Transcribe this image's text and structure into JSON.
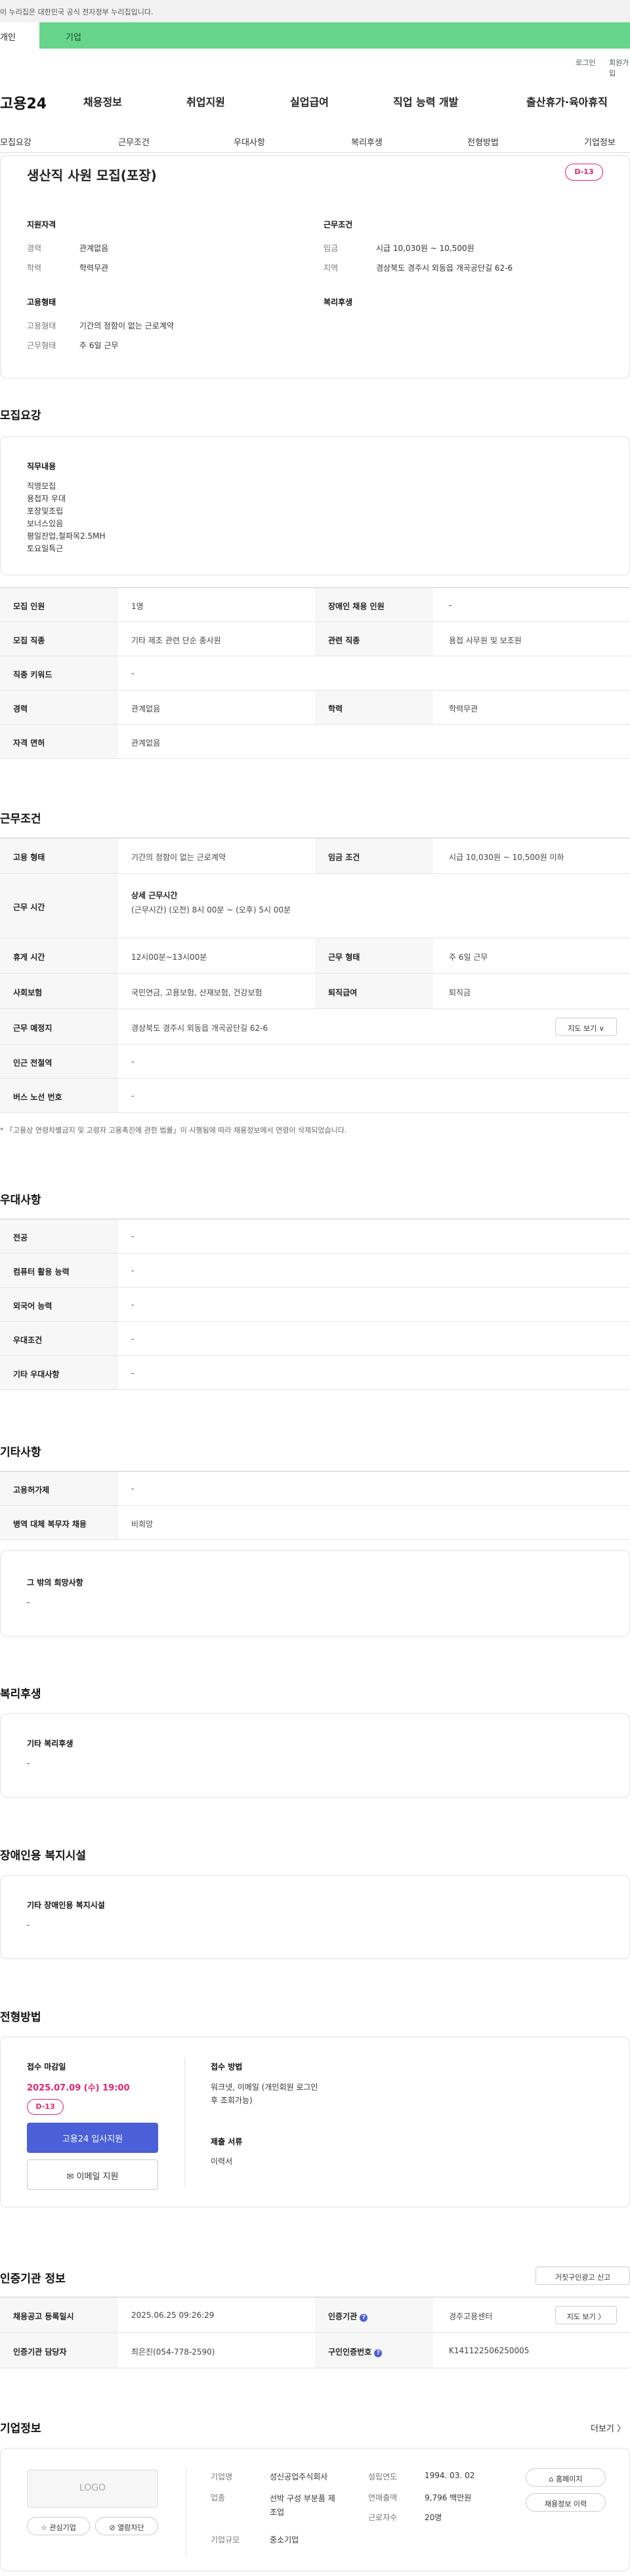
{
  "gov": "이 누리집은 대한민국 공식 전자정부 누리집입니다.",
  "tabs": {
    "person": "개인",
    "company": "기업"
  },
  "util": {
    "login": "로그인",
    "join": "회원가입"
  },
  "logo": "고용24",
  "gnb": [
    "채용정보",
    "취업지원",
    "실업급여",
    "직업 능력 개발",
    "출산휴가·육아휴직"
  ],
  "subnav": [
    "모집요강",
    "근무조건",
    "우대사항",
    "복리후생",
    "전형방법",
    "기업정보"
  ],
  "summary": {
    "title": "생산직 사원 모집(포장)",
    "dday": "D-13",
    "qual_h": "지원자격",
    "career_l": "경력",
    "career_v": "관계없음",
    "edu_l": "학력",
    "edu_v": "학력무관",
    "cond_h": "근무조건",
    "wage_l": "임금",
    "wage_v": "시급 10,030원 ~ 10,500원",
    "loc_l": "지역",
    "loc_v": "경상북도 경주시 외동읍 개곡공단길 62-6",
    "emp_h": "고용형태",
    "emp_l": "고용형태",
    "emp_v": "기간의 정함이 없는 근로계약",
    "work_l": "근무형태",
    "work_v": "주 6일 근무",
    "welfare_h": "복리후생"
  },
  "recruit": {
    "h": "모집요강",
    "duty_h": "직무내용",
    "duty_lines": [
      "직영모집",
      "용접자 우대",
      "포장및조립",
      "보너스있음",
      "평일잔업,철파목2.5MH",
      "토요일특근"
    ],
    "rows": [
      [
        "모집 인원",
        "1명",
        "장애인 채용 인원",
        "-"
      ],
      [
        "모집 직종",
        "기타 제조 관련 단순 종사원",
        "관련 직종",
        "용접 사무원 및 보조원"
      ],
      [
        "직종 키워드",
        "-"
      ],
      [
        "경력",
        "관계없음",
        "학력",
        "학력무관"
      ],
      [
        "자격 면허",
        "관계없음"
      ]
    ]
  },
  "cond": {
    "h": "근무조건",
    "r1": [
      "고용 형태",
      "기간의 정함이 없는 근로계약",
      "임금 조건",
      "시급 10,030원 ~ 10,500원 이하"
    ],
    "r2": [
      "근무 시간",
      "상세 근무시간",
      "(근무시간) (오전) 8시 00분 ~ (오후) 5시 00분"
    ],
    "r3": [
      "휴게 시간",
      "12시00분~13시00분",
      "근무 형태",
      "주 6일 근무"
    ],
    "r4": [
      "사회보험",
      "국민연금, 고용보험, 산재보험, 건강보험",
      "퇴직급여",
      "퇴직금"
    ],
    "r5": [
      "근무 예정지",
      "경상북도 경주시 외동읍 개곡공단길 62-6",
      "지도 보기 ∨"
    ],
    "r6": [
      "인근 전철역",
      "-"
    ],
    "r7": [
      "버스 노선 번호",
      "-"
    ],
    "note": "* 「고용상 연령차별금지 및 고령자 고용촉진에 관한 법률」이 시행됨에 따라 채용정보에서 연령이 삭제되었습니다."
  },
  "pref": {
    "h": "우대사항",
    "rows": [
      [
        "전공",
        "-"
      ],
      [
        "컴퓨터 활용 능력",
        "-"
      ],
      [
        "외국어 능력",
        "-"
      ],
      [
        "우대조건",
        "-"
      ],
      [
        "기타 우대사항",
        "-"
      ]
    ]
  },
  "etc": {
    "h": "기타사항",
    "rows": [
      [
        "고용허가제",
        "-"
      ],
      [
        "병역 대체 복무자 채용",
        "비희망"
      ]
    ],
    "other_h": "그 밖의 희망사항",
    "other_v": "-"
  },
  "welfare": {
    "h": "복리후생",
    "sub": "기타 복리후생",
    "v": "-"
  },
  "disab": {
    "h": "장애인용 복지시설",
    "sub": "기타 장애인용 복지시설",
    "v": "-"
  },
  "screen": {
    "h": "전형방법",
    "deadline_l": "접수 마감일",
    "deadline_v": "2025.07.09 (수) 19:00",
    "dday": "D-13",
    "apply": "고용24 입사지원",
    "email": "✉ 이메일 지원",
    "method_l": "접수 방법",
    "method_v": "워크넷, 이메일 (개인회원 로그인 후 조회가능)",
    "docs_l": "제출 서류",
    "docs_v": "이력서"
  },
  "cert": {
    "h": "인증기관 정보",
    "report": "거짓구인광고 신고",
    "reg_l": "채용공고 등록일시",
    "reg_v": "2025.06.25 09:26:29",
    "agency_l": "인증기관",
    "agency_v": "경주고용센터",
    "map": "지도 보기 〉",
    "mgr_l": "인증기관 담당자",
    "mgr_v": "최은진(054-778-2590)",
    "no_l": "구인인증번호",
    "no_v": "K141122506250005"
  },
  "company": {
    "h": "기업정보",
    "more": "더보기 〉",
    "logo": "LOGO",
    "fav": "☆ 관심기업",
    "block": "⊘ 열람차단",
    "name_l": "기업명",
    "name_v": "성신공업주식회사",
    "ind_l": "업종",
    "ind_v": "선박 구성 부분품 제조업",
    "size_l": "기업규모",
    "size_v": "중소기업",
    "est_l": "설립연도",
    "est_v": "1994. 03. 02",
    "rev_l": "연매출액",
    "rev_v": "9,796 백만원",
    "emp_l": "근로자수",
    "emp_v": "20명",
    "home": "홈페이지",
    "hist": "채용정보 이력"
  }
}
